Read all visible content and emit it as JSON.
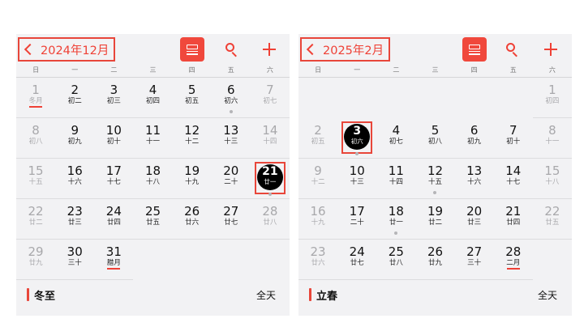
{
  "weekdays": [
    "日",
    "一",
    "二",
    "三",
    "四",
    "五",
    "六"
  ],
  "left": {
    "month_label": "2024年12月",
    "leading_blanks": 0,
    "days": [
      {
        "n": "1",
        "l": "冬月",
        "w": true,
        "u": true
      },
      {
        "n": "2",
        "l": "初二"
      },
      {
        "n": "3",
        "l": "初三"
      },
      {
        "n": "4",
        "l": "初四"
      },
      {
        "n": "5",
        "l": "初五"
      },
      {
        "n": "6",
        "l": "初六",
        "dot": true
      },
      {
        "n": "7",
        "l": "初七",
        "w": true
      },
      {
        "n": "8",
        "l": "初八",
        "w": true
      },
      {
        "n": "9",
        "l": "初九"
      },
      {
        "n": "10",
        "l": "初十"
      },
      {
        "n": "11",
        "l": "十一"
      },
      {
        "n": "12",
        "l": "十二"
      },
      {
        "n": "13",
        "l": "十三"
      },
      {
        "n": "14",
        "l": "十四",
        "w": true
      },
      {
        "n": "15",
        "l": "十五",
        "w": true
      },
      {
        "n": "16",
        "l": "十六"
      },
      {
        "n": "17",
        "l": "十七"
      },
      {
        "n": "18",
        "l": "十八"
      },
      {
        "n": "19",
        "l": "十九"
      },
      {
        "n": "20",
        "l": "二十"
      },
      {
        "n": "21",
        "l": "廿一",
        "w": true,
        "sel": true,
        "dot": true
      },
      {
        "n": "22",
        "l": "廿二",
        "w": true
      },
      {
        "n": "23",
        "l": "廿三"
      },
      {
        "n": "24",
        "l": "廿四"
      },
      {
        "n": "25",
        "l": "廿五"
      },
      {
        "n": "26",
        "l": "廿六"
      },
      {
        "n": "27",
        "l": "廿七"
      },
      {
        "n": "28",
        "l": "廿八",
        "w": true
      },
      {
        "n": "29",
        "l": "廿九",
        "w": true
      },
      {
        "n": "30",
        "l": "三十"
      },
      {
        "n": "31",
        "l": "腊月",
        "u": true
      }
    ],
    "event_name": "冬至",
    "event_time": "全天"
  },
  "right": {
    "month_label": "2025年2月",
    "leading_blanks": 6,
    "days": [
      {
        "n": "1",
        "l": "初四",
        "w": true
      },
      {
        "n": "2",
        "l": "初五",
        "w": true
      },
      {
        "n": "3",
        "l": "初六",
        "sel": true,
        "dot": true
      },
      {
        "n": "4",
        "l": "初七"
      },
      {
        "n": "5",
        "l": "初八"
      },
      {
        "n": "6",
        "l": "初九"
      },
      {
        "n": "7",
        "l": "初十"
      },
      {
        "n": "8",
        "l": "十一",
        "w": true
      },
      {
        "n": "9",
        "l": "十二",
        "w": true
      },
      {
        "n": "10",
        "l": "十三"
      },
      {
        "n": "11",
        "l": "十四"
      },
      {
        "n": "12",
        "l": "十五",
        "dot": true
      },
      {
        "n": "13",
        "l": "十六"
      },
      {
        "n": "14",
        "l": "十七"
      },
      {
        "n": "15",
        "l": "十八",
        "w": true
      },
      {
        "n": "16",
        "l": "十九",
        "w": true
      },
      {
        "n": "17",
        "l": "二十"
      },
      {
        "n": "18",
        "l": "廿一",
        "dot": true
      },
      {
        "n": "19",
        "l": "廿二"
      },
      {
        "n": "20",
        "l": "廿三"
      },
      {
        "n": "21",
        "l": "廿四"
      },
      {
        "n": "22",
        "l": "廿五",
        "w": true
      },
      {
        "n": "23",
        "l": "廿六",
        "w": true
      },
      {
        "n": "24",
        "l": "廿七"
      },
      {
        "n": "25",
        "l": "廿八"
      },
      {
        "n": "26",
        "l": "廿九"
      },
      {
        "n": "27",
        "l": "三十"
      },
      {
        "n": "28",
        "l": "二月",
        "u": true
      }
    ],
    "event_name": "立春",
    "event_time": "全天"
  },
  "icons": {
    "back": "chevron-left-icon",
    "list": "list-view-icon",
    "search": "search-icon",
    "add": "plus-icon"
  },
  "colors": {
    "accent": "#ef4136",
    "highlight_box": "#e8463a",
    "selected_day": "#000000",
    "panel_bg": "#f2f2f4",
    "weekend_text": "#a8a8ab"
  }
}
